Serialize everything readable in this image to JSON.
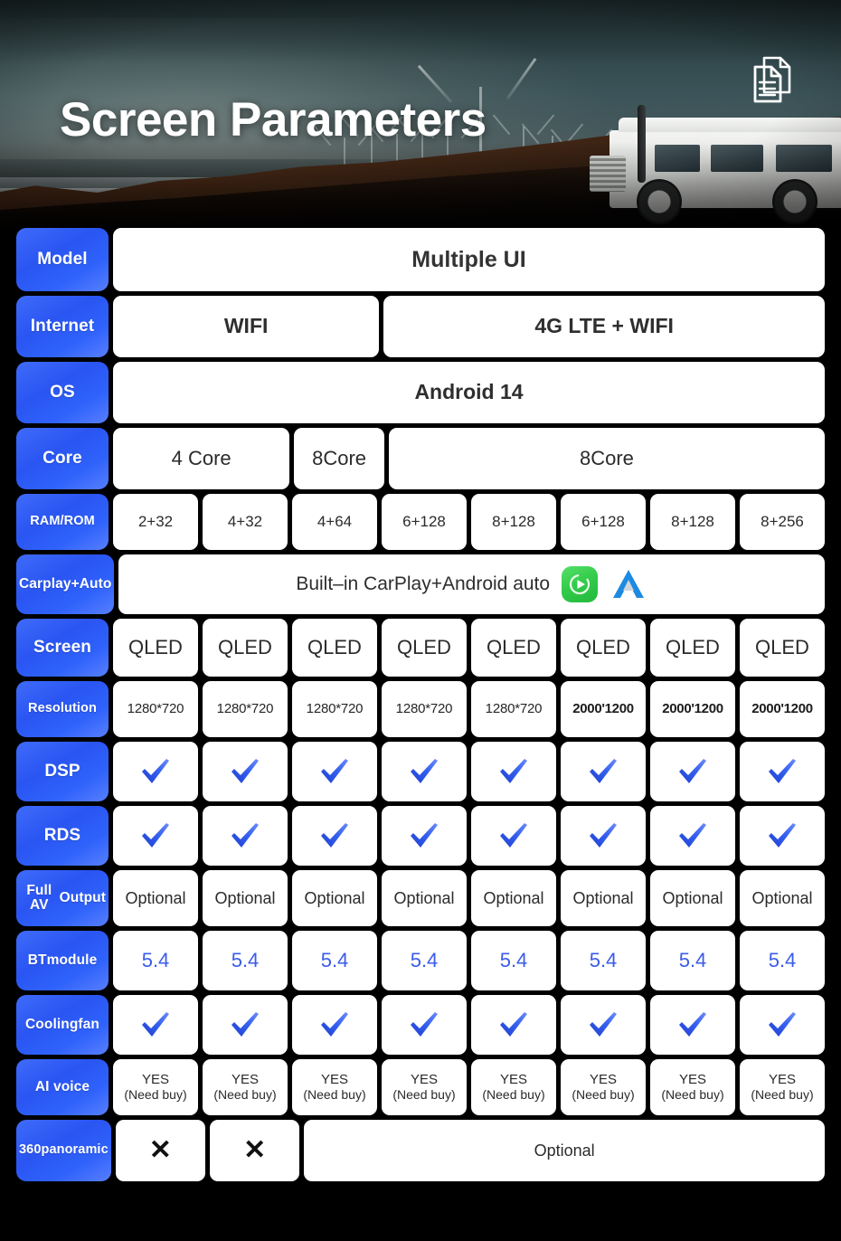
{
  "hero": {
    "title": "Screen Parameters",
    "doc_icon": "documents-icon"
  },
  "table": {
    "rows": [
      {
        "label": "Model",
        "label_style": "normal",
        "cells": [
          {
            "text": "Multiple UI",
            "span": 8,
            "style": "t-big"
          }
        ]
      },
      {
        "label": "Internet",
        "label_style": "normal",
        "cells": [
          {
            "text": "WIFI",
            "span": 3,
            "style": "t-mid"
          },
          {
            "text": "4G LTE + WIFI",
            "span": 5,
            "style": "t-mid"
          }
        ]
      },
      {
        "label": "OS",
        "label_style": "normal",
        "cells": [
          {
            "text": "Android 14",
            "span": 8,
            "style": "t-mid"
          }
        ]
      },
      {
        "label": "Core",
        "label_style": "normal",
        "cells": [
          {
            "text": "4 Core",
            "span": 2,
            "style": "t-reg"
          },
          {
            "text": "8Core",
            "span": 1,
            "style": "t-reg"
          },
          {
            "text": "8Core",
            "span": 5,
            "style": "t-reg"
          }
        ]
      },
      {
        "label": "RAM/ROM",
        "label_style": "xs",
        "cells": [
          {
            "text": "2+32",
            "span": 1,
            "style": "t-small"
          },
          {
            "text": "4+32",
            "span": 1,
            "style": "t-small"
          },
          {
            "text": "4+64",
            "span": 1,
            "style": "t-small"
          },
          {
            "text": "6+128",
            "span": 1,
            "style": "t-small"
          },
          {
            "text": "8+128",
            "span": 1,
            "style": "t-small"
          },
          {
            "text": "6+128",
            "span": 1,
            "style": "t-small"
          },
          {
            "text": "8+128",
            "span": 1,
            "style": "t-small"
          },
          {
            "text": "8+256",
            "span": 1,
            "style": "t-small"
          }
        ]
      },
      {
        "label": "Carplay\n+Auto",
        "label_style": "sm",
        "type": "carplay",
        "carplay_text": "Built–in CarPlay+Android auto",
        "cells": [
          {
            "text": "",
            "span": 8,
            "style": "t-reg"
          }
        ]
      },
      {
        "label": "Screen",
        "label_style": "normal",
        "cells": [
          {
            "text": "QLED",
            "span": 1,
            "style": "t-reg"
          },
          {
            "text": "QLED",
            "span": 1,
            "style": "t-reg"
          },
          {
            "text": "QLED",
            "span": 1,
            "style": "t-reg"
          },
          {
            "text": "QLED",
            "span": 1,
            "style": "t-reg"
          },
          {
            "text": "QLED",
            "span": 1,
            "style": "t-reg"
          },
          {
            "text": "QLED",
            "span": 1,
            "style": "t-reg"
          },
          {
            "text": "QLED",
            "span": 1,
            "style": "t-reg"
          },
          {
            "text": "QLED",
            "span": 1,
            "style": "t-reg"
          }
        ]
      },
      {
        "label": "Resolution",
        "label_style": "xs",
        "cells": [
          {
            "text": "1280*720",
            "span": 1,
            "style": "t-tiny"
          },
          {
            "text": "1280*720",
            "span": 1,
            "style": "t-tiny"
          },
          {
            "text": "1280*720",
            "span": 1,
            "style": "t-tiny"
          },
          {
            "text": "1280*720",
            "span": 1,
            "style": "t-tiny"
          },
          {
            "text": "1280*720",
            "span": 1,
            "style": "t-tiny"
          },
          {
            "text": "2000'1200",
            "span": 1,
            "style": "t-bold-tiny"
          },
          {
            "text": "2000'1200",
            "span": 1,
            "style": "t-bold-tiny"
          },
          {
            "text": "2000'1200",
            "span": 1,
            "style": "t-bold-tiny"
          }
        ]
      },
      {
        "label": "DSP",
        "label_style": "normal",
        "type": "checks",
        "count": 8
      },
      {
        "label": "RDS",
        "label_style": "normal",
        "type": "checks",
        "count": 8
      },
      {
        "label": "Full AV\nOutput",
        "label_style": "sm",
        "cells": [
          {
            "text": "Optional",
            "span": 1,
            "style": "t-optional"
          },
          {
            "text": "Optional",
            "span": 1,
            "style": "t-optional"
          },
          {
            "text": "Optional",
            "span": 1,
            "style": "t-optional"
          },
          {
            "text": "Optional",
            "span": 1,
            "style": "t-optional"
          },
          {
            "text": "Optional",
            "span": 1,
            "style": "t-optional"
          },
          {
            "text": "Optional",
            "span": 1,
            "style": "t-optional"
          },
          {
            "text": "Optional",
            "span": 1,
            "style": "t-optional"
          },
          {
            "text": "Optional",
            "span": 1,
            "style": "t-optional"
          }
        ]
      },
      {
        "label": "BT\nmodule",
        "label_style": "sm",
        "cells": [
          {
            "text": "5.4",
            "span": 1,
            "style": "t-blue"
          },
          {
            "text": "5.4",
            "span": 1,
            "style": "t-blue"
          },
          {
            "text": "5.4",
            "span": 1,
            "style": "t-blue"
          },
          {
            "text": "5.4",
            "span": 1,
            "style": "t-blue"
          },
          {
            "text": "5.4",
            "span": 1,
            "style": "t-blue"
          },
          {
            "text": "5.4",
            "span": 1,
            "style": "t-blue"
          },
          {
            "text": "5.4",
            "span": 1,
            "style": "t-blue"
          },
          {
            "text": "5.4",
            "span": 1,
            "style": "t-blue"
          }
        ]
      },
      {
        "label": "Cooling\nfan",
        "label_style": "sm",
        "type": "checks",
        "count": 8
      },
      {
        "label": "AI voice",
        "label_style": "sm",
        "type": "ai",
        "yes_text": "YES",
        "need_text": "(Need buy)",
        "count": 8
      },
      {
        "label": "360\npanoramic",
        "label_style": "xs",
        "cells": [
          {
            "text": "✕",
            "span": 1,
            "style": "t-x"
          },
          {
            "text": "✕",
            "span": 1,
            "style": "t-x"
          },
          {
            "text": "Optional",
            "span": 6,
            "style": "t-optional"
          }
        ]
      }
    ]
  },
  "colors": {
    "label_blue": "#2a55f2",
    "check_blue": "#2f5ee8",
    "bt_blue": "#3b5ce8",
    "carplay_green": "#35cc4c",
    "androidauto_blue": "#1d8ae0",
    "page_bg": "#000000",
    "cell_bg": "#ffffff"
  }
}
